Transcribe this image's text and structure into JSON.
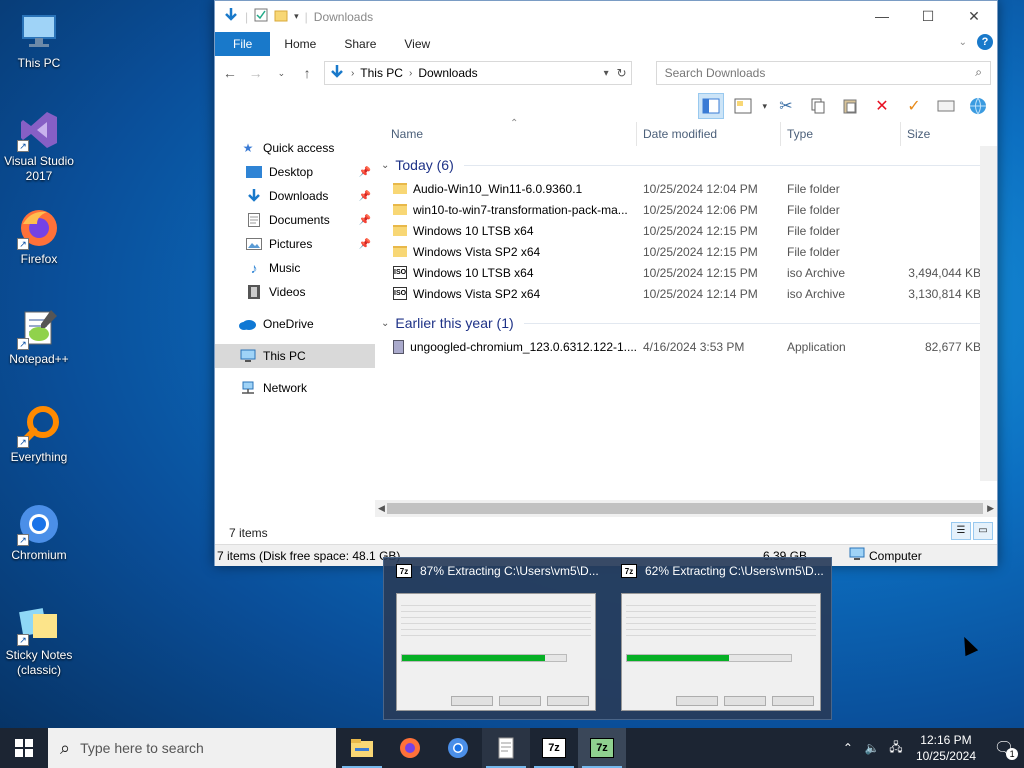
{
  "desktop": {
    "icons": [
      {
        "label": "This PC"
      },
      {
        "label": "Visual Studio\n2017"
      },
      {
        "label": "Firefox"
      },
      {
        "label": "Notepad++"
      },
      {
        "label": "Everything"
      },
      {
        "label": "Chromium"
      },
      {
        "label": "Sticky Notes\n(classic)"
      }
    ]
  },
  "explorer": {
    "title": "Downloads",
    "tabs": {
      "file": "File",
      "home": "Home",
      "share": "Share",
      "view": "View"
    },
    "address": {
      "seg1": "This PC",
      "seg2": "Downloads"
    },
    "search_placeholder": "Search Downloads",
    "columns": {
      "name": "Name",
      "date": "Date modified",
      "type": "Type",
      "size": "Size"
    },
    "nav": {
      "quick_access": "Quick access",
      "desktop": "Desktop",
      "downloads": "Downloads",
      "documents": "Documents",
      "pictures": "Pictures",
      "music": "Music",
      "videos": "Videos",
      "onedrive": "OneDrive",
      "this_pc": "This PC",
      "network": "Network"
    },
    "groups": [
      {
        "label": "Today (6)",
        "rows": [
          {
            "name": "Audio-Win10_Win11-6.0.9360.1",
            "date": "10/25/2024 12:04 PM",
            "type": "File folder",
            "size": ""
          },
          {
            "name": "win10-to-win7-transformation-pack-ma...",
            "date": "10/25/2024 12:06 PM",
            "type": "File folder",
            "size": ""
          },
          {
            "name": "Windows 10 LTSB x64",
            "date": "10/25/2024 12:15 PM",
            "type": "File folder",
            "size": ""
          },
          {
            "name": "Windows Vista SP2 x64",
            "date": "10/25/2024 12:15 PM",
            "type": "File folder",
            "size": ""
          },
          {
            "name": "Windows 10 LTSB x64",
            "date": "10/25/2024 12:15 PM",
            "type": "iso Archive",
            "size": "3,494,044 KB"
          },
          {
            "name": "Windows Vista SP2 x64",
            "date": "10/25/2024 12:14 PM",
            "type": "iso Archive",
            "size": "3,130,814 KB"
          }
        ]
      },
      {
        "label": "Earlier this year (1)",
        "rows": [
          {
            "name": "ungoogled-chromium_123.0.6312.122-1....",
            "date": "4/16/2024 3:53 PM",
            "type": "Application",
            "size": "82,677 KB"
          }
        ]
      }
    ],
    "status_items": "7 items",
    "status2_left": "7 items (Disk free space: 48.1 GB)",
    "status2_size": "6.39 GB",
    "status2_computer": "Computer"
  },
  "preview": {
    "items": [
      {
        "title": "87% Extracting C:\\Users\\vm5\\D...",
        "progress": 0.87
      },
      {
        "title": "62% Extracting C:\\Users\\vm5\\D...",
        "progress": 0.62
      }
    ],
    "sz_label": "7z"
  },
  "taskbar": {
    "search_placeholder": "Type here to search",
    "time": "12:16 PM",
    "date": "10/25/2024",
    "notif_count": "1"
  },
  "colors": {
    "accent": "#1979ca",
    "progress": "#06b025",
    "taskbar": "#1c2533"
  }
}
